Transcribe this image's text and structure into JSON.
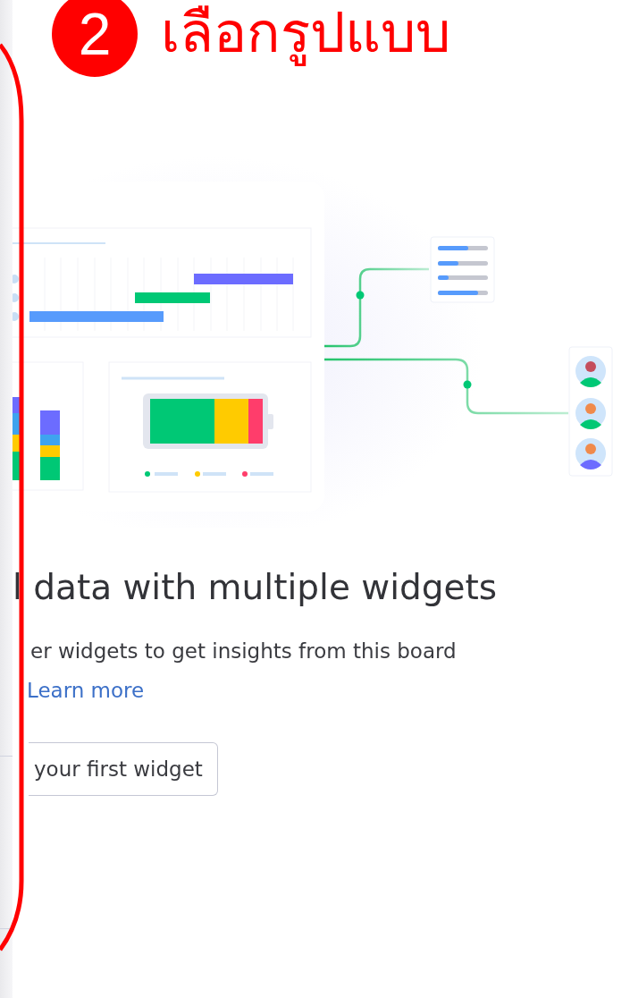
{
  "annotation": {
    "step": "2",
    "label": "เลือกรูปแบบ"
  },
  "empty_state": {
    "title": "l data with multiple widgets",
    "description": "er widgets to get insights from this board",
    "link": "Learn more",
    "button": "your first widget"
  }
}
